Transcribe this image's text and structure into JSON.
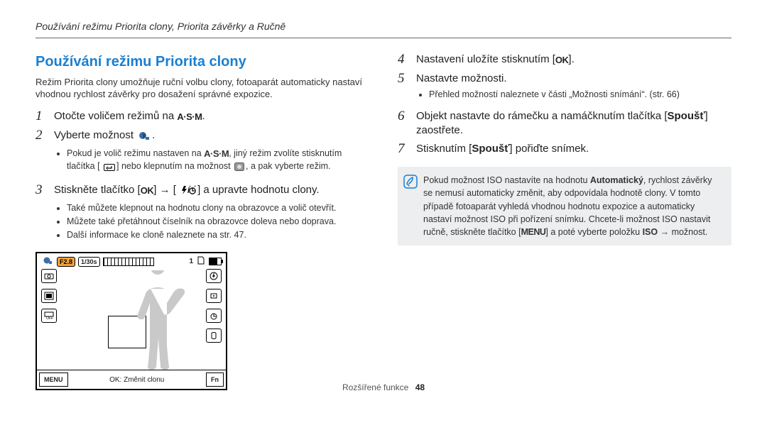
{
  "header": {
    "breadcrumb": "Používání režimu Priorita clony, Priorita závěrky a Ručně"
  },
  "left": {
    "title": "Používání režimu Priorita clony",
    "intro": "Režim Priorita clony umožňuje ruční volbu clony, fotoaparát automaticky nastaví vhodnou rychlost závěrky pro dosažení správné expozice.",
    "steps": {
      "s1": {
        "num": "1",
        "pre": "Otočte voličem režimů na ",
        "post": "."
      },
      "s2": {
        "num": "2",
        "pre": "Vyberte možnost ",
        "post": ".",
        "sub1a": "Pokud je volič režimu nastaven na ",
        "sub1b": ", jiný režim zvolíte stisknutím tlačítka [",
        "sub1c": "] nebo klepnutím na možnost ",
        "sub1d": ", a pak vyberte režim."
      },
      "s3": {
        "num": "3",
        "pre": "Stiskněte tlačítko [",
        "arrow": "] → [",
        "post": "] a upravte hodnotu clony.",
        "sub1": "Také můžete klepnout na hodnotu clony na obrazovce a volič otevřít.",
        "sub2": "Můžete také přetáhnout číselník na obrazovce doleva nebo doprava.",
        "sub3": "Další informace ke cloně naleznete na str. 47."
      }
    },
    "screen": {
      "f_value": "F2.8",
      "shutter": "1/30s",
      "count": "1",
      "menu_btn": "MENU",
      "mid_label": "OK: Změnit clonu",
      "fn_btn": "Fn"
    }
  },
  "right": {
    "steps": {
      "s4": {
        "num": "4",
        "pre": "Nastavení uložíte stisknutím [",
        "post": "]."
      },
      "s5": {
        "num": "5",
        "text": "Nastavte možnosti.",
        "sub1": "Přehled možností naleznete v části „Možnosti snímání“. (str. 66)"
      },
      "s6": {
        "num": "6",
        "pre": "Objekt nastavte do rámečku a namáčknutím tlačítka [",
        "bold": "Spoušť",
        "post": "] zaostřete."
      },
      "s7": {
        "num": "7",
        "pre": "Stisknutím [",
        "bold": "Spoušť",
        "post": "] pořiďte snímek."
      }
    },
    "note": {
      "l1a": "Pokud možnost ISO nastavíte na hodnotu ",
      "l1bold": "Automatický",
      "l1b": ", rychlost závěrky se nemusí automaticky změnit, aby odpovídala hodnotě clony. V tomto případě fotoaparát vyhledá vhodnou hodnotu expozice a automaticky nastaví možnost ISO při pořízení snímku. Chcete-li možnost ISO nastavit ručně, stiskněte tlačítko [",
      "menu": "MENU",
      "l1c": "] a poté vyberte položku ",
      "iso": "ISO",
      "l1d": " → možnost."
    }
  },
  "footer": {
    "section": "Rozšířené funkce",
    "page": "48"
  },
  "icons": {
    "ok": "OK",
    "asm": "A·S·M"
  }
}
